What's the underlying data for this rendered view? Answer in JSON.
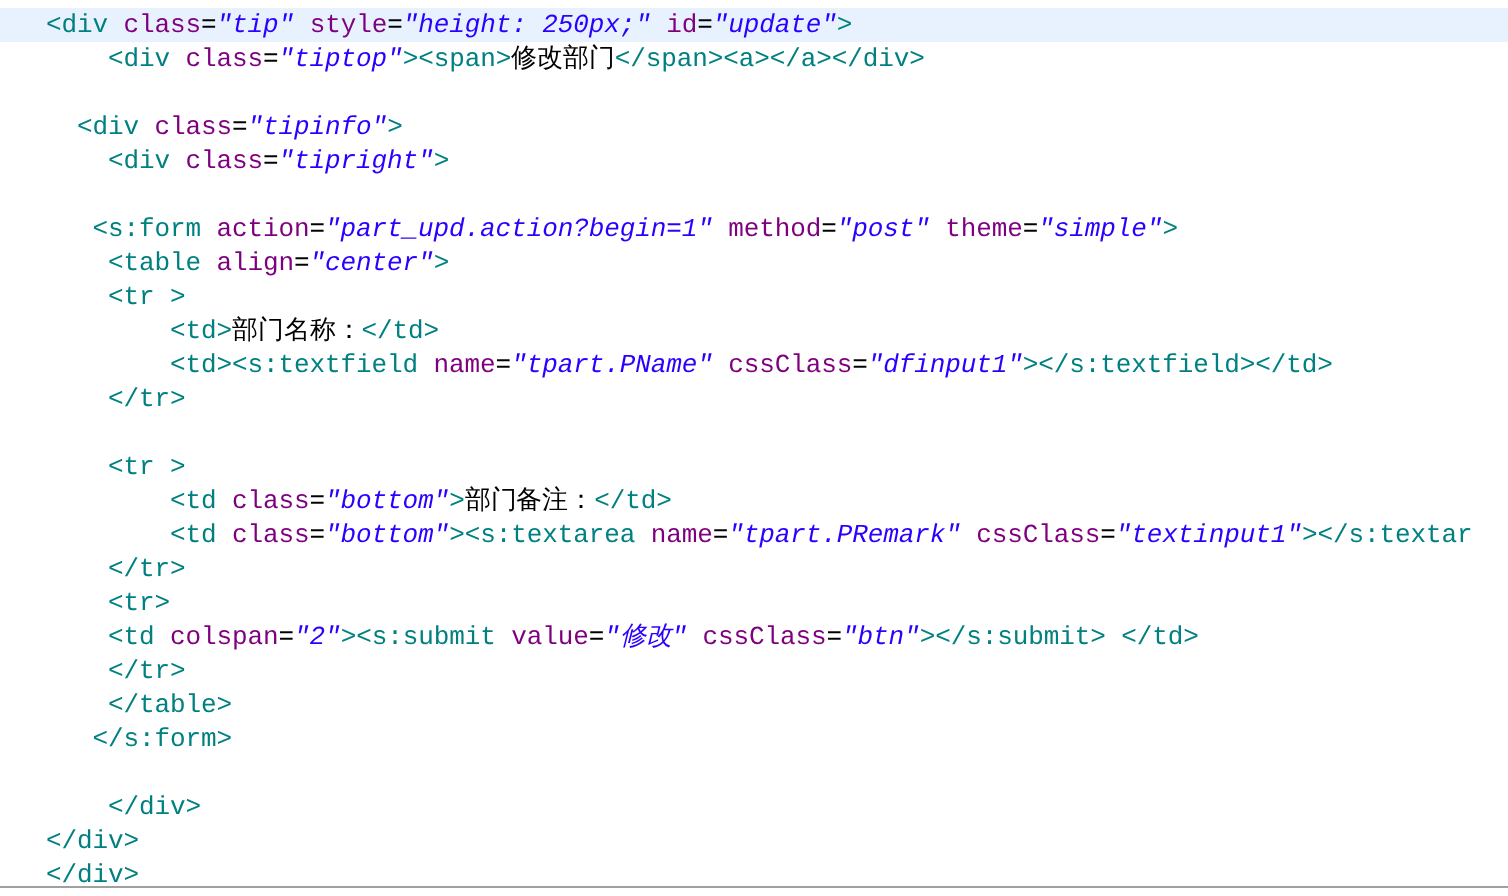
{
  "editor": {
    "lines": [
      {
        "current": true,
        "tokens": [
          {
            "kind": "tag",
            "text": "<div"
          },
          {
            "kind": "attr",
            "text": " class"
          },
          {
            "kind": "eq",
            "text": "="
          },
          {
            "kind": "value",
            "text": "\"tip\""
          },
          {
            "kind": "attr",
            "text": " style"
          },
          {
            "kind": "eq",
            "text": "="
          },
          {
            "kind": "value",
            "text": "\"height: 250px;\""
          },
          {
            "kind": "attr",
            "text": " id"
          },
          {
            "kind": "eq",
            "text": "="
          },
          {
            "kind": "value",
            "text": "\"update\""
          },
          {
            "kind": "tag",
            "text": ">"
          }
        ]
      },
      {
        "current": false,
        "tokens": [
          {
            "kind": "tag",
            "text": "    <div"
          },
          {
            "kind": "attr",
            "text": " class"
          },
          {
            "kind": "eq",
            "text": "="
          },
          {
            "kind": "value",
            "text": "\"tiptop\""
          },
          {
            "kind": "tag",
            "text": "><span>"
          },
          {
            "kind": "text",
            "text": "修改部门"
          },
          {
            "kind": "tag",
            "text": "</span><a></a></div>"
          }
        ]
      },
      {
        "current": false
      },
      {
        "current": false,
        "tokens": [
          {
            "kind": "tag",
            "text": "  <div"
          },
          {
            "kind": "attr",
            "text": " class"
          },
          {
            "kind": "eq",
            "text": "="
          },
          {
            "kind": "value",
            "text": "\"tipinfo\""
          },
          {
            "kind": "tag",
            "text": ">"
          }
        ]
      },
      {
        "current": false,
        "tokens": [
          {
            "kind": "tag",
            "text": "    <div"
          },
          {
            "kind": "attr",
            "text": " class"
          },
          {
            "kind": "eq",
            "text": "="
          },
          {
            "kind": "value",
            "text": "\"tipright\""
          },
          {
            "kind": "tag",
            "text": ">"
          }
        ]
      },
      {
        "current": false
      },
      {
        "current": false,
        "tokens": [
          {
            "kind": "tag",
            "text": "   <s:form"
          },
          {
            "kind": "attr",
            "text": " action"
          },
          {
            "kind": "eq",
            "text": "="
          },
          {
            "kind": "value",
            "text": "\"part_upd.action?begin=1\""
          },
          {
            "kind": "attr",
            "text": " method"
          },
          {
            "kind": "eq",
            "text": "="
          },
          {
            "kind": "value",
            "text": "\"post\""
          },
          {
            "kind": "attr",
            "text": " theme"
          },
          {
            "kind": "eq",
            "text": "="
          },
          {
            "kind": "value",
            "text": "\"simple\""
          },
          {
            "kind": "tag",
            "text": ">"
          }
        ]
      },
      {
        "current": false,
        "tokens": [
          {
            "kind": "tag",
            "text": "    <table"
          },
          {
            "kind": "attr",
            "text": " align"
          },
          {
            "kind": "eq",
            "text": "="
          },
          {
            "kind": "value",
            "text": "\"center\""
          },
          {
            "kind": "tag",
            "text": ">"
          }
        ]
      },
      {
        "current": false,
        "tokens": [
          {
            "kind": "tag",
            "text": "    <tr >"
          }
        ]
      },
      {
        "current": false,
        "tokens": [
          {
            "kind": "tag",
            "text": "        <td>"
          },
          {
            "kind": "text",
            "text": "部门名称："
          },
          {
            "kind": "tag",
            "text": "</td>"
          }
        ]
      },
      {
        "current": false,
        "tokens": [
          {
            "kind": "tag",
            "text": "        <td><s:textfield"
          },
          {
            "kind": "attr",
            "text": " name"
          },
          {
            "kind": "eq",
            "text": "="
          },
          {
            "kind": "value",
            "text": "\"tpart.PName\""
          },
          {
            "kind": "attr",
            "text": " cssClass"
          },
          {
            "kind": "eq",
            "text": "="
          },
          {
            "kind": "value",
            "text": "\"dfinput1\""
          },
          {
            "kind": "tag",
            "text": "></s:textfield></td>"
          }
        ]
      },
      {
        "current": false,
        "tokens": [
          {
            "kind": "tag",
            "text": "    </tr>"
          }
        ]
      },
      {
        "current": false
      },
      {
        "current": false,
        "tokens": [
          {
            "kind": "tag",
            "text": "    <tr >"
          }
        ]
      },
      {
        "current": false,
        "tokens": [
          {
            "kind": "tag",
            "text": "        <td"
          },
          {
            "kind": "attr",
            "text": " class"
          },
          {
            "kind": "eq",
            "text": "="
          },
          {
            "kind": "value",
            "text": "\"bottom\""
          },
          {
            "kind": "tag",
            "text": ">"
          },
          {
            "kind": "text",
            "text": "部门备注："
          },
          {
            "kind": "tag",
            "text": "</td>"
          }
        ]
      },
      {
        "current": false,
        "tokens": [
          {
            "kind": "tag",
            "text": "        <td"
          },
          {
            "kind": "attr",
            "text": " class"
          },
          {
            "kind": "eq",
            "text": "="
          },
          {
            "kind": "value",
            "text": "\"bottom\""
          },
          {
            "kind": "tag",
            "text": "><s:textarea"
          },
          {
            "kind": "attr",
            "text": " name"
          },
          {
            "kind": "eq",
            "text": "="
          },
          {
            "kind": "value",
            "text": "\"tpart.PRemark\""
          },
          {
            "kind": "attr",
            "text": " cssClass"
          },
          {
            "kind": "eq",
            "text": "="
          },
          {
            "kind": "value",
            "text": "\"textinput1\""
          },
          {
            "kind": "tag",
            "text": "></s:textar"
          }
        ]
      },
      {
        "current": false,
        "tokens": [
          {
            "kind": "tag",
            "text": "    </tr>"
          }
        ]
      },
      {
        "current": false,
        "tokens": [
          {
            "kind": "tag",
            "text": "    <tr>"
          }
        ]
      },
      {
        "current": false,
        "tokens": [
          {
            "kind": "tag",
            "text": "    <td"
          },
          {
            "kind": "attr",
            "text": " colspan"
          },
          {
            "kind": "eq",
            "text": "="
          },
          {
            "kind": "value",
            "text": "\"2\""
          },
          {
            "kind": "tag",
            "text": "><s:submit"
          },
          {
            "kind": "attr",
            "text": " value"
          },
          {
            "kind": "eq",
            "text": "="
          },
          {
            "kind": "value",
            "text": "\"修改\""
          },
          {
            "kind": "attr",
            "text": " cssClass"
          },
          {
            "kind": "eq",
            "text": "="
          },
          {
            "kind": "value",
            "text": "\"btn\""
          },
          {
            "kind": "tag",
            "text": "></s:submit> </td>"
          }
        ]
      },
      {
        "current": false,
        "tokens": [
          {
            "kind": "tag",
            "text": "    </tr>"
          }
        ]
      },
      {
        "current": false,
        "tokens": [
          {
            "kind": "tag",
            "text": "    </table>"
          }
        ]
      },
      {
        "current": false,
        "tokens": [
          {
            "kind": "tag",
            "text": "   </s:form>"
          }
        ]
      },
      {
        "current": false
      },
      {
        "current": false,
        "tokens": [
          {
            "kind": "tag",
            "text": "    </div>"
          }
        ]
      },
      {
        "current": false,
        "tokens": [
          {
            "kind": "tag",
            "text": "</div>"
          }
        ]
      },
      {
        "current": false,
        "tokens": [
          {
            "kind": "tag",
            "text": "</div>"
          }
        ]
      }
    ]
  }
}
